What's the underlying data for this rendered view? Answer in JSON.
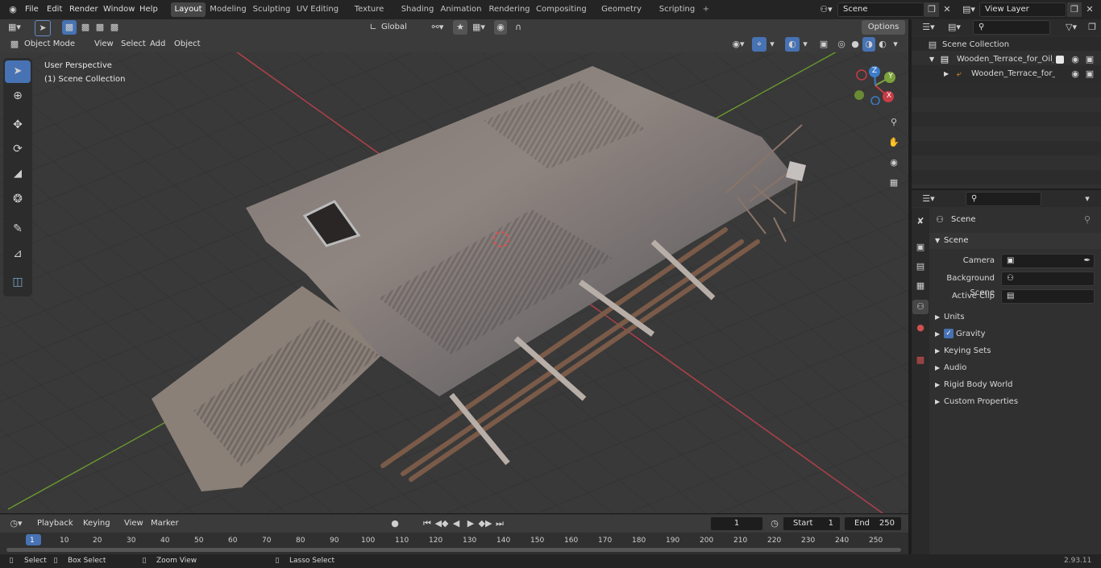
{
  "topbar": {
    "menus": [
      "File",
      "Edit",
      "Render",
      "Window",
      "Help"
    ],
    "workspaces": [
      "Layout",
      "Modeling",
      "Sculpting",
      "UV Editing",
      "Texture Paint",
      "Shading",
      "Animation",
      "Rendering",
      "Compositing",
      "Geometry Nodes",
      "Scripting"
    ],
    "active_workspace": "Layout",
    "add": "+",
    "scene": "Scene",
    "view_layer": "View Layer"
  },
  "viewport_header": {
    "orientation": "Global",
    "options": "Options",
    "mode": "Object Mode",
    "menus": [
      "View",
      "Select",
      "Add",
      "Object"
    ]
  },
  "overlay": {
    "perspective": "User Perspective",
    "collection": "(1) Scene Collection"
  },
  "gizmo": {
    "x": "X",
    "y": "Y",
    "z": "Z"
  },
  "outliner": {
    "root": "Scene Collection",
    "items": [
      {
        "label": "Wooden_Terrace_for_Oil_Derr"
      },
      {
        "label": "Wooden_Terrace_for_Oil_"
      }
    ]
  },
  "properties": {
    "context": "Scene",
    "section": "Scene",
    "camera_label": "Camera",
    "background_scene_label": "Background Scene",
    "active_clip_label": "Active Clip",
    "panels": [
      "Units",
      "Gravity",
      "Keying Sets",
      "Audio",
      "Rigid Body World",
      "Custom Properties"
    ]
  },
  "timeline": {
    "menus": [
      "Playback",
      "Keying",
      "View",
      "Marker"
    ],
    "current_frame": "1",
    "start_label": "Start",
    "start": "1",
    "end_label": "End",
    "end": "250",
    "ticks": [
      "1",
      "10",
      "20",
      "30",
      "40",
      "50",
      "60",
      "70",
      "80",
      "90",
      "100",
      "110",
      "120",
      "130",
      "140",
      "150",
      "160",
      "170",
      "180",
      "190",
      "200",
      "210",
      "220",
      "230",
      "240",
      "250"
    ]
  },
  "statusbar": {
    "items": [
      "Select",
      "Box Select",
      "Zoom View",
      "Lasso Select"
    ],
    "version": "2.93.11"
  },
  "colors": {
    "accent": "#4772b3",
    "x_axis": "#c83c46",
    "y_axis": "#7ca23c",
    "z_axis": "#3c7cc8"
  }
}
